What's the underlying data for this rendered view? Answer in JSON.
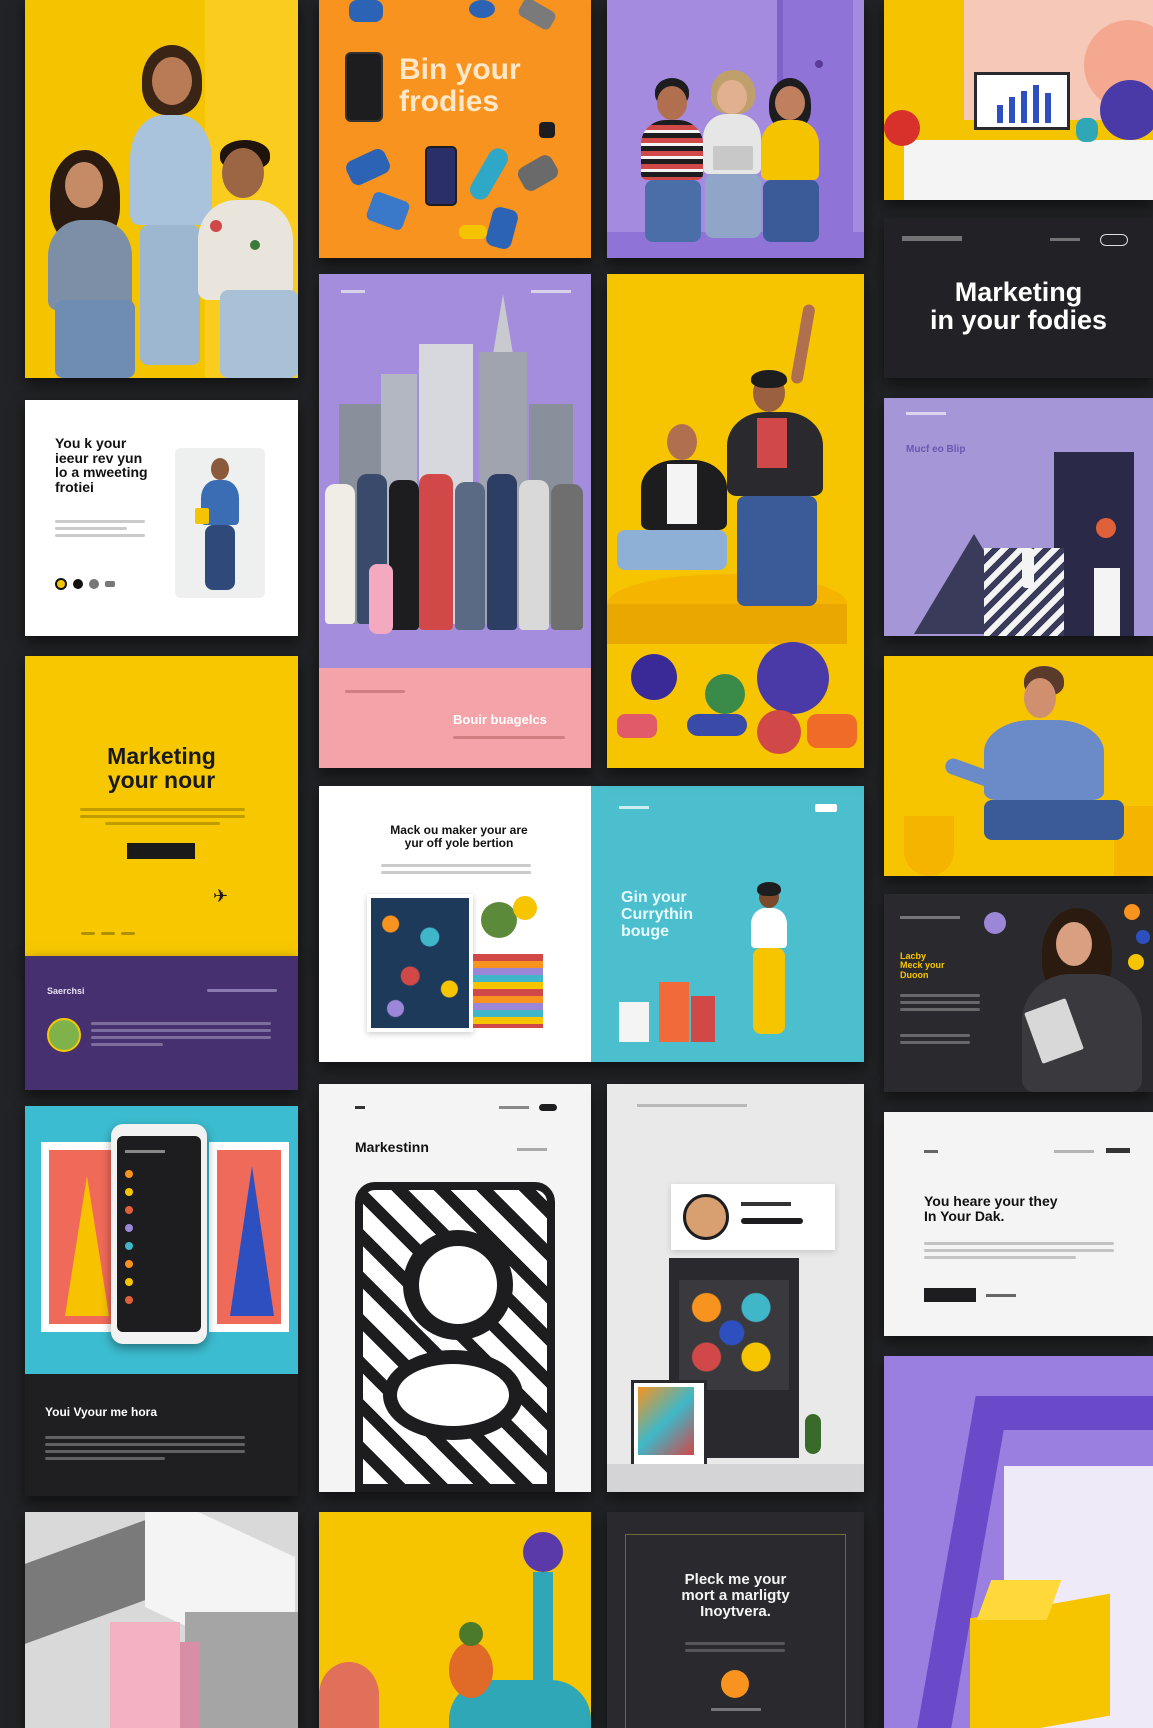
{
  "tiles": {
    "t2": {
      "title": "Bin your\nfrodies"
    },
    "t6": {
      "title": "Marketing\nin your fodies"
    },
    "t7": {
      "title": "You k your\nieeur rev yun\nlo a mweeting\nfrotiei"
    },
    "t9": {
      "title": "Mucf eo Blip"
    },
    "t8": {
      "footer": "Bouir buagelcs"
    },
    "t11": {
      "title": "Marketing\nyour nour"
    },
    "t11b": {
      "label": "Saerchsi"
    },
    "t12": {
      "title": "Mack ou maker your are\nyur off yole bertion"
    },
    "t13": {
      "title": "Gin your\nCurrythin\nbouge"
    },
    "t15": {
      "title": "Lacby\nMeck your\nDuoon"
    },
    "t16": {
      "caption": "Youi Vyour me hora"
    },
    "t17": {
      "title": "Markestinn"
    },
    "t19": {
      "title": "You heare your they\nIn Your Dak."
    },
    "t22": {
      "title": "Pleck me your\nmort a marligty\nInoytvera."
    }
  },
  "colors": {
    "background": "#222326",
    "yellow": "#f7c500",
    "orange": "#f7931e",
    "purple": "#9c86d8",
    "deep_purple": "#4a3478",
    "teal": "#3fb7c8",
    "dark": "#1f1f22",
    "pink": "#f0a5a5"
  }
}
